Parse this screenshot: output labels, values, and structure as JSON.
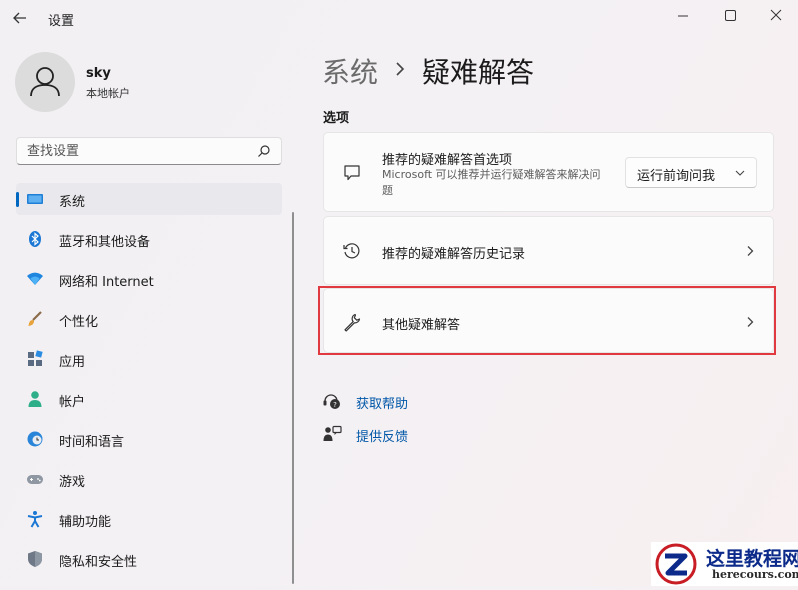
{
  "window": {
    "title": "设置",
    "controls": {
      "minimize": "minimize-icon",
      "maximize": "maximize-icon",
      "close": "close-icon"
    }
  },
  "user": {
    "name": "sky",
    "account_type": "本地帐户"
  },
  "search": {
    "placeholder": "查找设置"
  },
  "sidebar": {
    "items": [
      {
        "label": "系统",
        "icon": "monitor-icon",
        "selected": true
      },
      {
        "label": "蓝牙和其他设备",
        "icon": "bluetooth-icon"
      },
      {
        "label": "网络和 Internet",
        "icon": "wifi-icon"
      },
      {
        "label": "个性化",
        "icon": "brush-icon"
      },
      {
        "label": "应用",
        "icon": "apps-icon"
      },
      {
        "label": "帐户",
        "icon": "person-icon"
      },
      {
        "label": "时间和语言",
        "icon": "clock-globe-icon"
      },
      {
        "label": "游戏",
        "icon": "gamepad-icon"
      },
      {
        "label": "辅助功能",
        "icon": "accessibility-icon"
      },
      {
        "label": "隐私和安全性",
        "icon": "shield-icon"
      }
    ]
  },
  "breadcrumb": {
    "parent": "系统",
    "current": "疑难解答"
  },
  "main": {
    "section_label": "选项",
    "cards": [
      {
        "title": "推荐的疑难解答首选项",
        "description": "Microsoft 可以推荐并运行疑难解答来解决问题",
        "icon": "chat-bubble-icon",
        "dropdown_value": "运行前询问我"
      },
      {
        "title": "推荐的疑难解答历史记录",
        "icon": "history-icon"
      },
      {
        "title": "其他疑难解答",
        "icon": "wrench-icon"
      }
    ],
    "links": [
      {
        "label": "获取帮助",
        "icon": "help-icon"
      },
      {
        "label": "提供反馈",
        "icon": "feedback-icon"
      }
    ]
  },
  "watermark": {
    "title": "这里教程网",
    "url": "herecours.com"
  },
  "colors": {
    "accent": "#0067c0",
    "highlight": "#e0393f",
    "link": "#0057a8"
  }
}
